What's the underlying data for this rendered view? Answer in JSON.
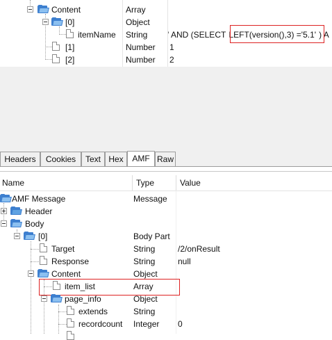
{
  "top_tree": {
    "rows": [
      {
        "name": "Content",
        "type": "Array",
        "value": ""
      },
      {
        "name": "[0]",
        "type": "Object",
        "value": ""
      },
      {
        "name": "itemName",
        "type": "String",
        "value": "' AND (SELECT LEFT(version(),3) ='5.1') A"
      },
      {
        "name": "[1]",
        "type": "Number",
        "value": "1"
      },
      {
        "name": "[2]",
        "type": "Number",
        "value": "2"
      }
    ],
    "itemname_prefix": "' AND (SELECT ",
    "itemname_highlight": "LEFT(version(),3) ='5.1'",
    "itemname_suffix": ") A"
  },
  "tabs": [
    "Headers",
    "Cookies",
    "Text",
    "Hex",
    "AMF",
    "Raw"
  ],
  "active_tab": "AMF",
  "columns": {
    "name": "Name",
    "type": "Type",
    "value": "Value"
  },
  "bottom_tree": {
    "rows": [
      {
        "name": "AMF Message",
        "type": "Message",
        "value": ""
      },
      {
        "name": "Header",
        "type": "",
        "value": ""
      },
      {
        "name": "Body",
        "type": "",
        "value": ""
      },
      {
        "name": "[0]",
        "type": "Body Part",
        "value": ""
      },
      {
        "name": "Target",
        "type": "String",
        "value": "/2/onResult"
      },
      {
        "name": "Response",
        "type": "String",
        "value": "null"
      },
      {
        "name": "Content",
        "type": "Object",
        "value": ""
      },
      {
        "name": "item_list",
        "type": "Array",
        "value": ""
      },
      {
        "name": "page_info",
        "type": "Object",
        "value": ""
      },
      {
        "name": "extends",
        "type": "String",
        "value": ""
      },
      {
        "name": "recordcount",
        "type": "Integer",
        "value": "0"
      }
    ]
  },
  "colors": {
    "highlight_box": "#dd2222",
    "folder": "#3d7fcf"
  }
}
